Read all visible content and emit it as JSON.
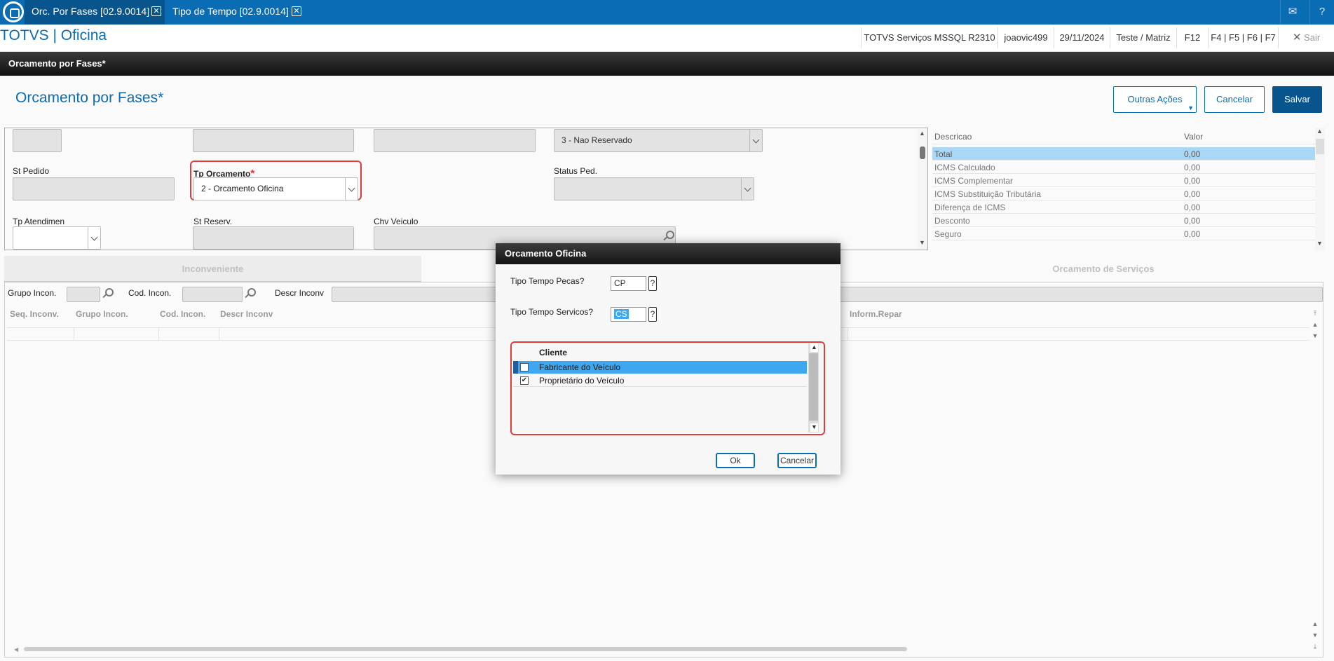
{
  "tabs": [
    {
      "label": "Orc. Por Fases [02.9.0014]"
    },
    {
      "label": "Tipo de Tempo [02.9.0014]"
    }
  ],
  "header": {
    "app_title": "TOTVS | Oficina",
    "environment": "TOTVS Serviços MSSQL R2310",
    "user": "joaovic499",
    "date": "29/11/2024",
    "branch": "Teste / Matriz",
    "f12": "F12",
    "shortcuts": "F4 | F5 | F6 | F7",
    "exit": "Sair"
  },
  "strip_title": "Orcamento por Fases*",
  "page": {
    "title": "Orcamento por Fases*",
    "other_actions": "Outras Ações",
    "cancel": "Cancelar",
    "save": "Salvar"
  },
  "form": {
    "reserva_value": "3 - Nao Reservado",
    "st_pedido_label": "St Pedido",
    "tp_orcamento_label": "Tp Orcamento",
    "required_mark": "*",
    "tp_orcamento_value": "2 - Orcamento Oficina",
    "status_ped_label": "Status Ped.",
    "tp_atendimen_label": "Tp Atendimen",
    "st_reserv_label": "St Reserv.",
    "chv_veiculo_label": "Chv Veiculo"
  },
  "desc_table": {
    "headers": [
      "Descricao",
      "Valor"
    ],
    "rows": [
      {
        "desc": "Total",
        "value": "0,00"
      },
      {
        "desc": "ICMS Calculado",
        "value": "0,00"
      },
      {
        "desc": "ICMS Complementar",
        "value": "0,00"
      },
      {
        "desc": "ICMS Substituição Tributária",
        "value": "0,00"
      },
      {
        "desc": "Diferença de ICMS",
        "value": "0,00"
      },
      {
        "desc": "Desconto",
        "value": "0,00"
      },
      {
        "desc": "Seguro",
        "value": "0,00"
      }
    ]
  },
  "subtabs": {
    "inconveniente": "Inconveniente",
    "orcamento_servicos": "Orcamento de Serviços"
  },
  "filters": {
    "grupo_incon": "Grupo Incon.",
    "cod_incon": "Cod. Incon.",
    "descr_inconv": "Descr Inconv"
  },
  "grid_headers": {
    "seq": "Seq. Inconv.",
    "grupo": "Grupo Incon.",
    "cod": "Cod. Incon.",
    "descr": "Descr Inconv",
    "inform": "Inform.Repar"
  },
  "modal": {
    "title": "Orcamento Oficina",
    "pecas_label": "Tipo Tempo Pecas?",
    "pecas_value": "CP",
    "servicos_label": "Tipo Tempo Servicos?",
    "servicos_value": "CS",
    "help": "?",
    "list_header": "Cliente",
    "items": [
      {
        "label": "Fabricante do Veículo",
        "checked": false,
        "selected": true
      },
      {
        "label": "Proprietário do Veículo",
        "checked": true,
        "selected": false
      }
    ],
    "ok": "Ok",
    "cancel": "Cancelar"
  },
  "colors": {
    "brand_blue": "#0a6cb3",
    "dark_blue": "#08548c",
    "selection": "#3ea7f0",
    "error_red": "#e23b3b"
  }
}
